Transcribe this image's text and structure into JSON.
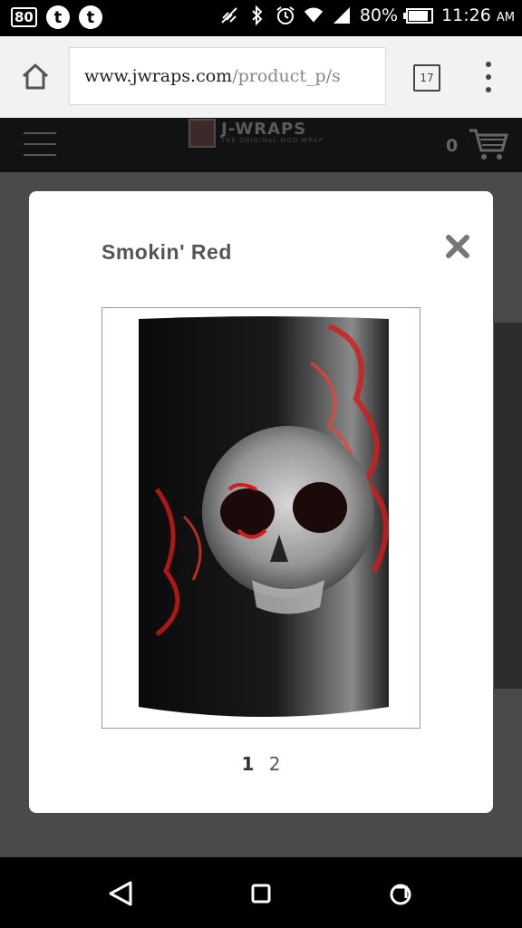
{
  "status_bar": {
    "badge": "80",
    "app_icon_1": "t",
    "app_icon_2": "t",
    "battery": "80%",
    "time": "11:26",
    "ampm": "AM"
  },
  "browser": {
    "url_host": "www.jwraps.com",
    "url_path": "/product_p/s",
    "tab_count": "17"
  },
  "site_header": {
    "logo_text": "J-WRAPS",
    "logo_tagline": "THE ORIGINAL MOD WRAP",
    "cart_count": "0"
  },
  "modal": {
    "title": "Smokin' Red",
    "pages": [
      "1",
      "2"
    ],
    "active_page": "1"
  },
  "icons": {
    "home": "home-icon",
    "menu": "overflow-menu-icon",
    "close": "close-icon",
    "cart": "shopping-cart-icon",
    "back": "back-icon",
    "recents": "recents-icon"
  }
}
